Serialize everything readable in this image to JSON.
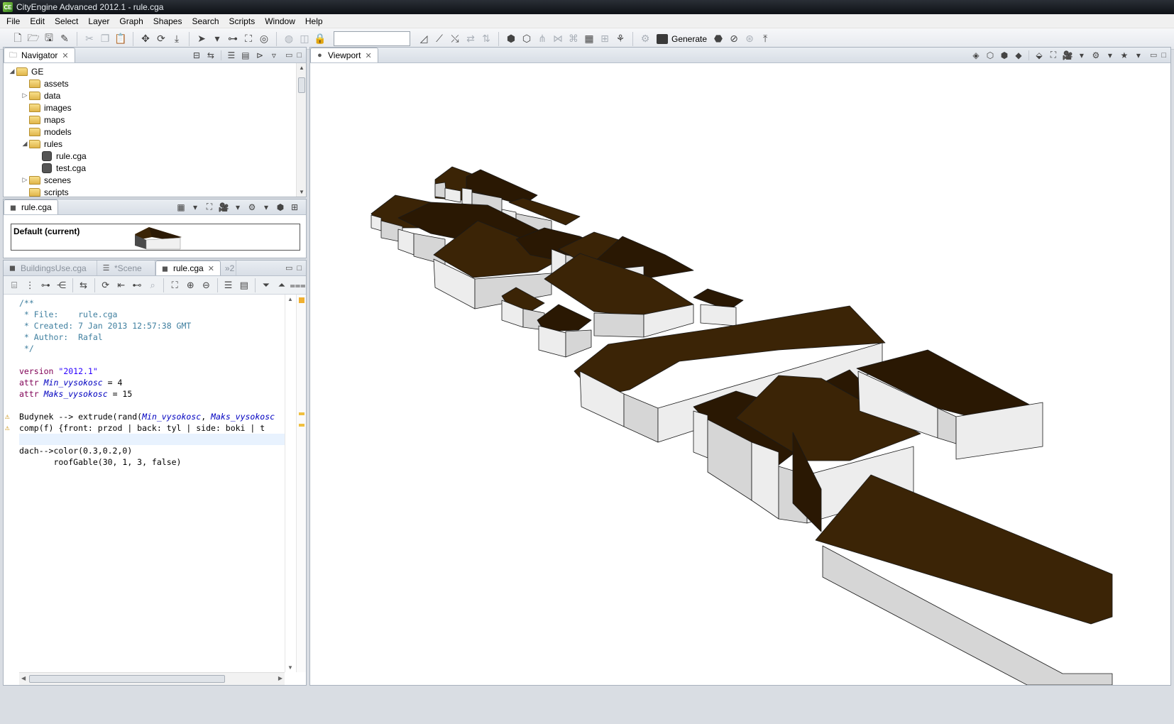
{
  "window": {
    "title": "CityEngine Advanced 2012.1 - rule.cga"
  },
  "menu": [
    "File",
    "Edit",
    "Select",
    "Layer",
    "Graph",
    "Shapes",
    "Search",
    "Scripts",
    "Window",
    "Help"
  ],
  "toolbar": {
    "generate_label": "Generate",
    "search_value": ""
  },
  "navigator": {
    "tab_label": "Navigator",
    "tree": [
      {
        "label": "GE",
        "level": 0,
        "type": "folder",
        "expanded": true
      },
      {
        "label": "assets",
        "level": 1,
        "type": "folder"
      },
      {
        "label": "data",
        "level": 1,
        "type": "folder",
        "collapsed": true
      },
      {
        "label": "images",
        "level": 1,
        "type": "folder"
      },
      {
        "label": "maps",
        "level": 1,
        "type": "folder"
      },
      {
        "label": "models",
        "level": 1,
        "type": "folder"
      },
      {
        "label": "rules",
        "level": 1,
        "type": "folder",
        "expanded": true
      },
      {
        "label": "rule.cga",
        "level": 2,
        "type": "cga"
      },
      {
        "label": "test.cga",
        "level": 2,
        "type": "cga"
      },
      {
        "label": "scenes",
        "level": 1,
        "type": "folder",
        "collapsed": true
      },
      {
        "label": "scripts",
        "level": 1,
        "type": "folder"
      }
    ]
  },
  "inspector": {
    "tab_label": "rule.cga",
    "style_label": "Default (current)"
  },
  "editor": {
    "tabs": [
      {
        "label": "BuildingsUse.cga",
        "state": "inactive"
      },
      {
        "label": "*Scene",
        "state": "inactive"
      },
      {
        "label": "rule.cga",
        "state": "active"
      },
      {
        "label": "»2",
        "state": "overflow"
      }
    ],
    "lines": [
      [
        {
          "t": "/**",
          "c": "comment"
        }
      ],
      [
        {
          "t": " * File:    rule.cga",
          "c": "comment"
        }
      ],
      [
        {
          "t": " * Created: 7 Jan 2013 12:57:38 GMT",
          "c": "comment"
        }
      ],
      [
        {
          "t": " * Author:  Rafal",
          "c": "comment"
        }
      ],
      [
        {
          "t": " */",
          "c": "comment"
        }
      ],
      [
        {
          "t": "",
          "c": "plain"
        }
      ],
      [
        {
          "t": "version ",
          "c": "kw"
        },
        {
          "t": "\"2012.1\"",
          "c": "str"
        }
      ],
      [
        {
          "t": "attr ",
          "c": "kw"
        },
        {
          "t": "Min_vysokosc",
          "c": "attr"
        },
        {
          "t": " = 4",
          "c": "plain"
        }
      ],
      [
        {
          "t": "attr ",
          "c": "kw"
        },
        {
          "t": "Maks_vysokosc",
          "c": "attr"
        },
        {
          "t": " = 15",
          "c": "plain"
        }
      ],
      [
        {
          "t": "",
          "c": "plain"
        }
      ],
      [
        {
          "t": "Budynek --> extrude(rand(",
          "c": "plain"
        },
        {
          "t": "Min_vysokosc",
          "c": "attr"
        },
        {
          "t": ", ",
          "c": "plain"
        },
        {
          "t": "Maks_vysokosc",
          "c": "attr"
        }
      ],
      [
        {
          "t": "comp(f) {front: przod | back: tyl | side: boki | t",
          "c": "plain"
        }
      ],
      [
        {
          "t": "",
          "c": "plain"
        }
      ],
      [
        {
          "t": "dach-->color(0.3,0.2,0)",
          "c": "plain"
        }
      ],
      [
        {
          "t": "       roofGable(30, 1, 3, false)",
          "c": "plain"
        }
      ]
    ],
    "warning_lines": [
      10,
      11
    ],
    "highlight_line": 12
  },
  "viewport": {
    "tab_label": "Viewport"
  },
  "colors": {
    "roof": "#3b2406",
    "roof_dark": "#2a1803",
    "wall_light": "#ededed",
    "wall_mid": "#d6d6d6",
    "wall_dark": "#b9b9b9"
  }
}
